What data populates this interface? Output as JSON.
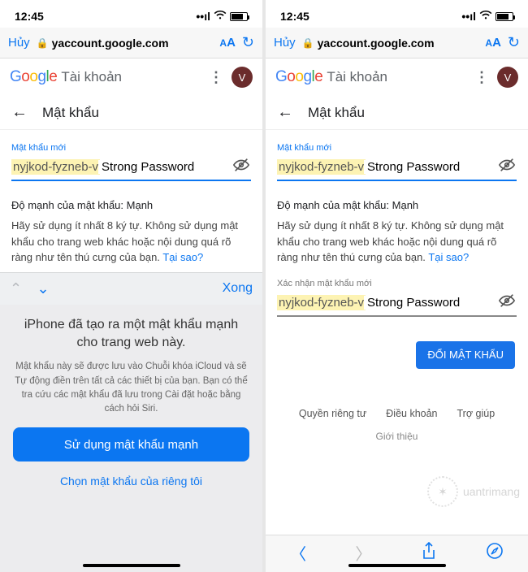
{
  "status": {
    "time": "12:45"
  },
  "safari": {
    "cancel": "Hủy",
    "url": "yaccount.google.com",
    "done": "Xong"
  },
  "google": {
    "account": "Tài khoản",
    "avatar": "V"
  },
  "page": {
    "title": "Mật khẩu"
  },
  "new_password": {
    "label": "Mật khẩu mới",
    "value_visible": "nyjkod-fyzneb-v",
    "strong_label": "Strong Password"
  },
  "confirm_password": {
    "label": "Xác nhận mật khẩu mới",
    "value_visible": "nyjkod-fyzneb-v",
    "strong_label": "Strong Password"
  },
  "strength": {
    "text": "Độ mạnh của mật khẩu: Mạnh"
  },
  "desc": {
    "text": "Hãy sử dụng ít nhất 8 ký tự. Không sử dụng mật khẩu cho trang web khác hoặc nội dung quá rõ ràng như tên thú cưng của bạn. ",
    "why": "Tại sao?"
  },
  "suggest": {
    "title": "iPhone đã tạo ra một mật khẩu mạnh cho trang web này.",
    "desc": "Mật khẩu này sẽ được lưu vào Chuỗi khóa iCloud và sẽ Tự động điền trên tất cả các thiết bị của bạn. Bạn có thể tra cứu các mật khẩu đã lưu trong Cài đặt hoặc bằng cách hỏi Siri.",
    "use_btn": "Sử dụng mật khẩu mạnh",
    "own_link": "Chọn mật khẩu của riêng tôi"
  },
  "change_btn": "ĐỔI MẬT KHẨU",
  "footer": {
    "privacy": "Quyền riêng tư",
    "terms": "Điều khoản",
    "help": "Trợ giúp",
    "about": "Giới thiệu"
  },
  "watermark": "uantrimang"
}
